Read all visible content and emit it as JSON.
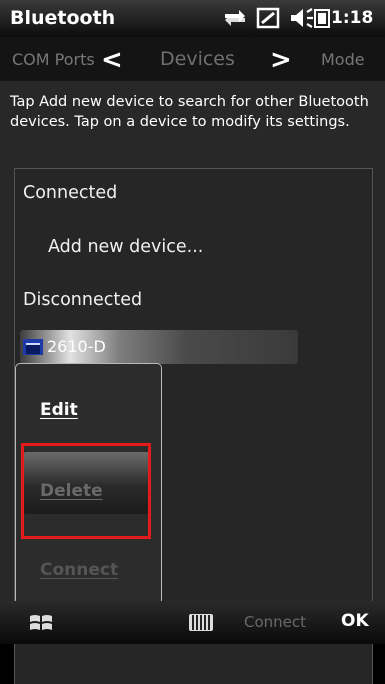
{
  "status_bar": {
    "app_title": "Bluetooth",
    "clock": "1:18",
    "icons": [
      "data-sync-icon",
      "signal-icon",
      "volume-icon",
      "battery-icon"
    ]
  },
  "tabs": {
    "left": "COM Ports",
    "current": "Devices",
    "right": "Mode"
  },
  "instructions": "Tap Add new device to search for other Bluetooth devices. Tap on a device to modify its settings.",
  "list": {
    "connected_header": "Connected",
    "add_new": "Add new device...",
    "disconnected_header": "Disconnected",
    "device_name": "2610-D"
  },
  "context_menu": {
    "items": [
      {
        "label": "Edit",
        "enabled": true
      },
      {
        "label": "Delete",
        "enabled": false,
        "highlighted": true
      },
      {
        "label": "Connect",
        "enabled": false
      }
    ]
  },
  "softkeys": {
    "center": "Connect",
    "right": "OK"
  },
  "colors": {
    "highlight_box": "#e41b1b",
    "background": "#282828"
  }
}
